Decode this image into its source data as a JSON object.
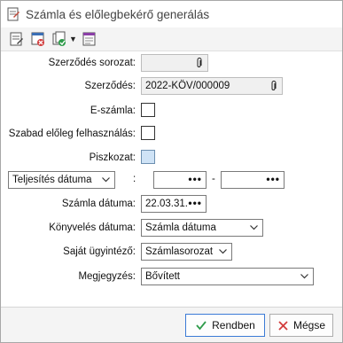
{
  "window": {
    "title": "Számla és előlegbekérő generálás"
  },
  "toolbar": {
    "buttons": [
      "generate-icon",
      "invoice-delete-icon",
      "copy-settings-icon",
      "dropdown-arrow",
      "calendar-invoice-icon"
    ]
  },
  "form": {
    "series_label": "Szerződés sorozat:",
    "series_value": "",
    "contract_label": "Szerződés:",
    "contract_value": "2022-KÖV/000009",
    "einvoice_label": "E-számla:",
    "free_advance_label": "Szabad előleg felhasználás:",
    "draft_label": "Piszkozat:",
    "date_type_value": "Teljesítés dátuma",
    "colon": ":",
    "dash": "-",
    "dots": "•••",
    "invoice_date_label": "Számla dátuma:",
    "invoice_date_value": "22.03.31.",
    "booking_date_label": "Könyvelés dátuma:",
    "booking_date_value": "Számla dátuma",
    "own_agent_label": "Saját ügyintéző:",
    "own_agent_value": "Számlasorozat",
    "note_label": "Megjegyzés:",
    "note_value": "Bővített"
  },
  "footer": {
    "ok_label": "Rendben",
    "cancel_label": "Mégse"
  },
  "colors": {
    "accent": "#3b7bd6",
    "ok_check": "#2e9b4a",
    "cancel_x": "#d23c3c",
    "draft_checkbox": "#cfe3f6"
  }
}
